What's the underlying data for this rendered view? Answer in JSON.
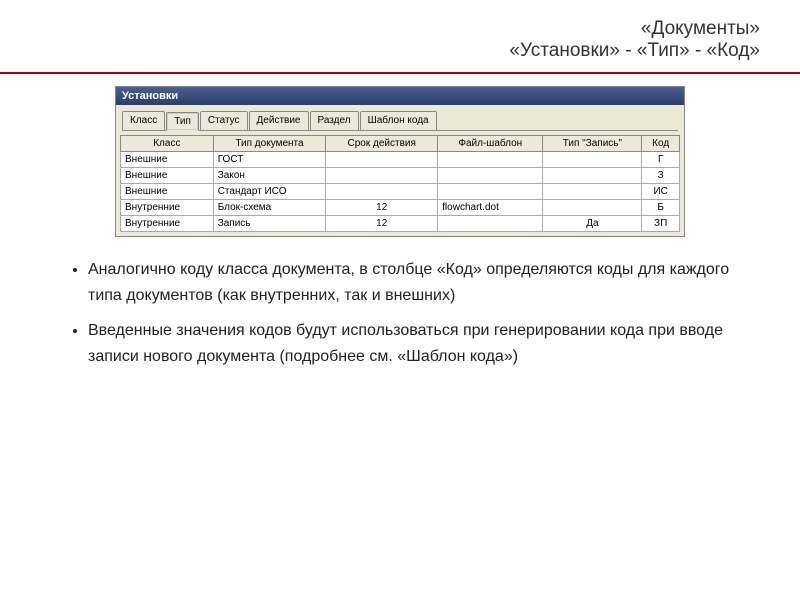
{
  "header": {
    "line1": "«Документы»",
    "line2": "«Установки» - «Тип» - «Код»"
  },
  "window": {
    "title": "Установки",
    "tabs": [
      "Класс",
      "Тип",
      "Статус",
      "Действие",
      "Раздел",
      "Шаблон кода"
    ],
    "columns": [
      "Класс",
      "Тип документа",
      "Срок действия",
      "Файл-шаблон",
      "Тип \"Запись\"",
      "Код"
    ],
    "rows": [
      {
        "class": "Внешние",
        "doctype": "ГОСТ",
        "term": "",
        "file": "",
        "rectype": "",
        "code": "Г"
      },
      {
        "class": "Внешние",
        "doctype": "Закон",
        "term": "",
        "file": "",
        "rectype": "",
        "code": "З"
      },
      {
        "class": "Внешние",
        "doctype": "Стандарт ИСО",
        "term": "",
        "file": "",
        "rectype": "",
        "code": "ИС"
      },
      {
        "class": "Внутренние",
        "doctype": "Блок-схема",
        "term": "12",
        "file": "flowchart.dot",
        "rectype": "",
        "code": "Б"
      },
      {
        "class": "Внутренние",
        "doctype": "Запись",
        "term": "12",
        "file": "",
        "rectype": "Да",
        "code": "ЗП"
      }
    ]
  },
  "bullets": [
    "Аналогично коду класса документа, в столбце «Код» определяются коды для каждого типа документов (как внутренних, так и внешних)",
    "Введенные значения кодов будут использоваться при генерировании кода при вводе записи нового документа (подробнее см. «Шаблон кода»)"
  ]
}
